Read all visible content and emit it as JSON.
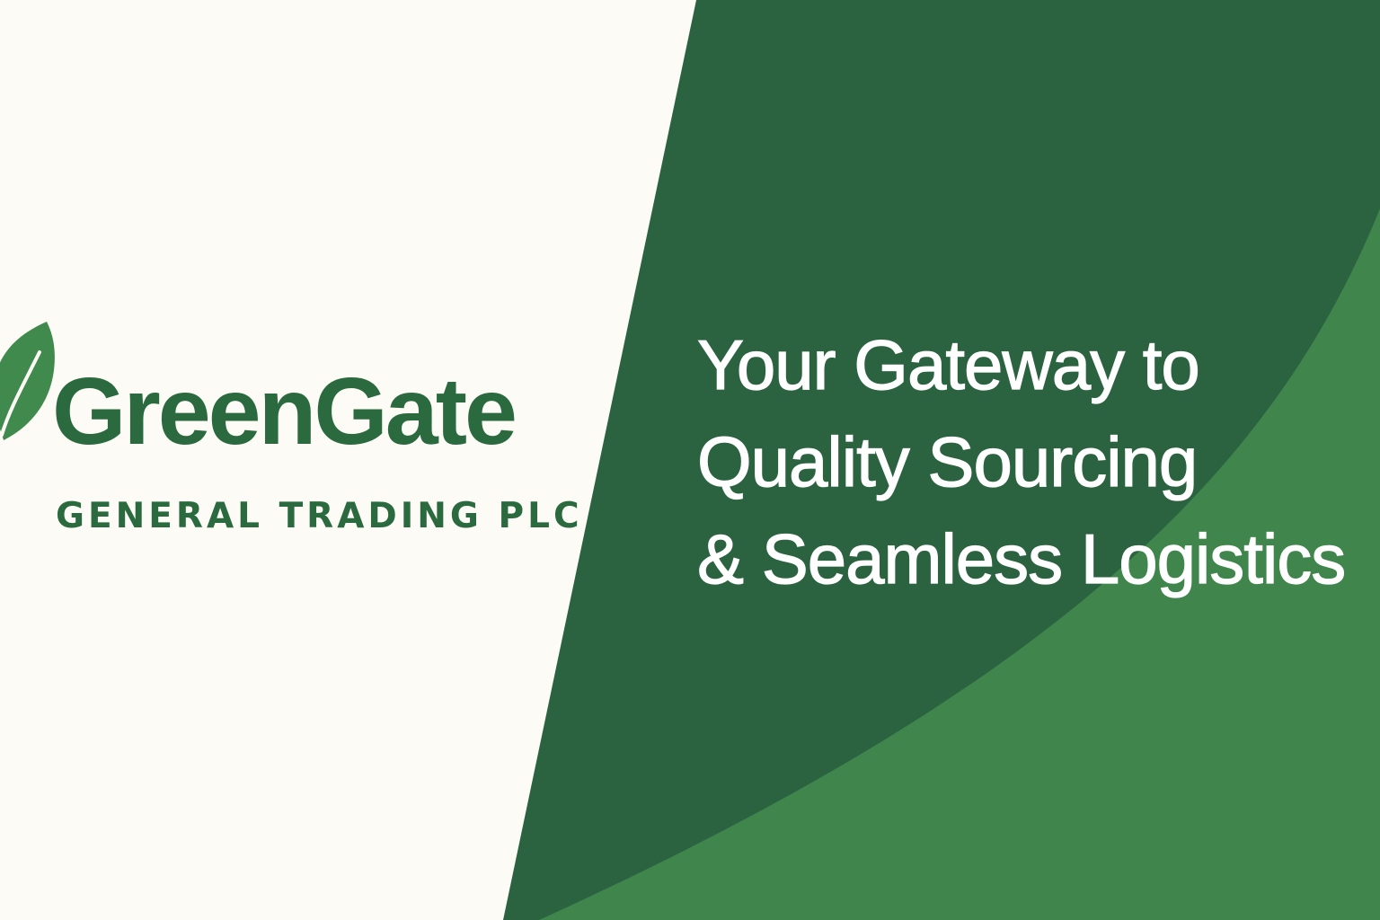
{
  "brand": {
    "name": "GreenGate",
    "subtitle": "GENERAL TRADING PLC"
  },
  "tagline": {
    "lines": [
      "Your Gateway to",
      "Quality Sourcing",
      "& Seamless Logistics"
    ]
  },
  "colors": {
    "background": "#fcfbf6",
    "dark_green": "#2b6340",
    "light_green": "#3f854c",
    "brand_text": "#2b6a3f",
    "leaf": "#3f8a4c",
    "tagline_text": "#ffffff"
  },
  "icons": {
    "logo": "leaf-icon"
  }
}
